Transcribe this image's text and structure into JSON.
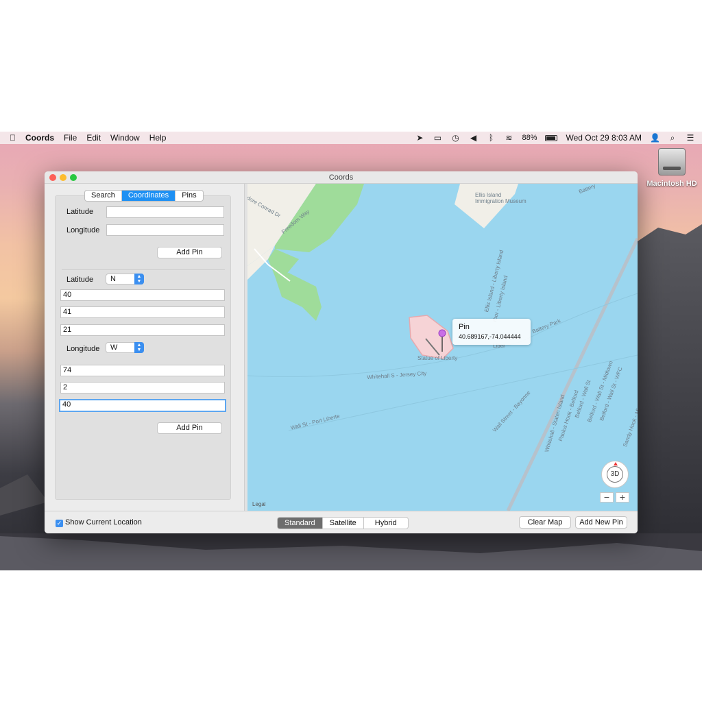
{
  "menubar": {
    "apple_icon": "apple-logo-icon",
    "app": "Coords",
    "menus": [
      "File",
      "Edit",
      "Window",
      "Help"
    ],
    "battery": "88%",
    "clock": "Wed Oct 29  8:03 AM"
  },
  "desktop": {
    "hd_label": "Macintosh HD"
  },
  "window": {
    "title": "Coords",
    "tabs": [
      "Search",
      "Coordinates",
      "Pins"
    ],
    "active_tab": "Coordinates",
    "decimal": {
      "latitude_label": "Latitude",
      "longitude_label": "Longitude",
      "latitude_value": "",
      "longitude_value": "",
      "add_pin": "Add Pin"
    },
    "dms": {
      "latitude_label": "Latitude",
      "latitude_hemisphere": "N",
      "lat_deg": "40",
      "lat_min": "41",
      "lat_sec": "21",
      "longitude_label": "Longitude",
      "longitude_hemisphere": "W",
      "lon_deg": "74",
      "lon_min": "2",
      "lon_sec": "40",
      "add_pin": "Add Pin"
    },
    "map": {
      "callout_title": "Pin",
      "callout_coords": "40.689167,-74.044444",
      "labels": {
        "ellis": "Ellis Island",
        "immigration": "Immigration Museum",
        "statue": "Statue of Liberty",
        "whitehall_jc": "Whitehall S - Jersey City",
        "wallst_pl": "Wall St - Port Liberte",
        "wallst_bayonne": "Wall Street - Bayonne",
        "freedom_way": "Freedom Way",
        "conrad": "dore Conrad Dr",
        "battery": "Battery",
        "battery_park": "Battery Park",
        "ellis_liberty": "Ellis Island - Liberty Island",
        "liberty_island": "rbor - Liberty Island",
        "liberty": "Liber",
        "whitehall_si": "Whitehall - Staten Island",
        "paulus": "Paulus Hook - Belford",
        "belford1": "Belford - Wall St",
        "belford2": "Belford - Wall St - Midtown",
        "belford3": "Belford - Wall St - WFC",
        "sandy": "Sandy Hook - Mi"
      },
      "compass_label": "3D",
      "zoom_out": "−",
      "zoom_in": "+",
      "legal": "Legal",
      "colors": {
        "water": "#9ad6ef",
        "park": "#9fdc9a",
        "land": "#f1efe8",
        "pin": "#c96ee6",
        "island": "#f6d3d6"
      }
    },
    "bottom": {
      "show_location": "Show Current Location",
      "show_location_checked": true,
      "map_types": [
        "Standard",
        "Satellite",
        "Hybrid"
      ],
      "active_map_type": "Standard",
      "clear_map": "Clear Map",
      "add_new_pin": "Add New Pin"
    }
  }
}
